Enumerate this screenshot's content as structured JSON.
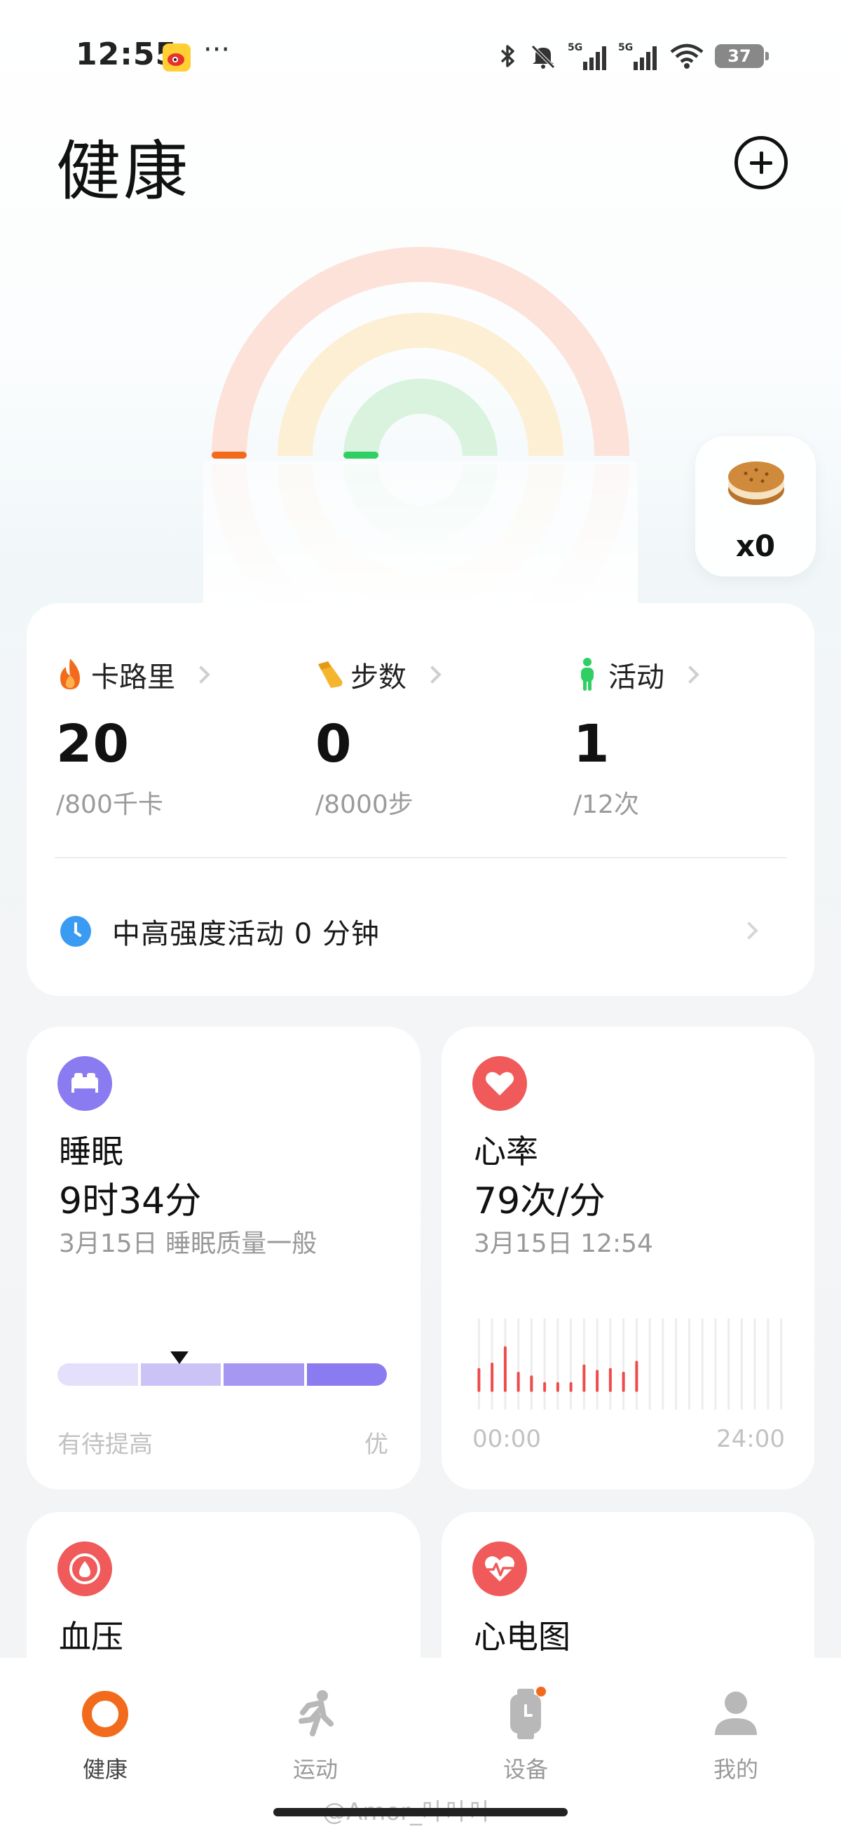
{
  "status_bar": {
    "time": "12:55",
    "dots": "···",
    "battery": "37",
    "network_label": "5G"
  },
  "header": {
    "title": "健康",
    "add_icon": "plus-circle-icon"
  },
  "rings": {
    "outer_color": "#f26b1d",
    "middle_color": "#f5b52f",
    "inner_color": "#2fcf63",
    "outer_progress": 0.025,
    "middle_progress": 0.0,
    "inner_progress": 0.083
  },
  "reward": {
    "icon": "cookie-icon",
    "count": "x0"
  },
  "summary": {
    "calories": {
      "label": "卡路里",
      "value": "20",
      "goal": "/800千卡",
      "icon": "flame-icon",
      "color": "#f26b1d"
    },
    "steps": {
      "label": "步数",
      "value": "0",
      "goal": "/8000步",
      "icon": "shoe-icon",
      "color": "#f5b52f"
    },
    "activity": {
      "label": "活动",
      "value": "1",
      "goal": "/12次",
      "icon": "person-standing-icon",
      "color": "#2fcf63"
    },
    "intensity": {
      "text": "中高强度活动  0  分钟",
      "icon": "clock-icon"
    }
  },
  "sleep": {
    "title": "睡眠",
    "value": "9时34分",
    "sub": "3月15日 睡眠质量一般",
    "scale_low": "有待提高",
    "scale_high": "优",
    "icon": "bed-icon",
    "icon_color": "#8b7bf0",
    "quality_level": 0.37
  },
  "heart_rate": {
    "title": "心率",
    "value": "79次/分",
    "sub": "3月15日 12:54",
    "x_start": "00:00",
    "x_end": "24:00",
    "icon": "heart-icon",
    "icon_color": "#f05a5a"
  },
  "chart_data": {
    "type": "bar",
    "title": "",
    "xlabel": "",
    "ylabel": "",
    "x": [
      0,
      1,
      2,
      3,
      4,
      5,
      6,
      7,
      8,
      9,
      10,
      11,
      12
    ],
    "values": [
      72,
      75,
      84,
      70,
      68,
      64,
      62,
      63,
      74,
      71,
      72,
      70,
      76
    ],
    "x_ticks": [
      "00:00",
      "24:00"
    ],
    "ylim": [
      50,
      100
    ],
    "grid": true
  },
  "blood_pressure": {
    "title": "血压",
    "icon": "blood-drop-icon",
    "icon_color": "#f05a5a"
  },
  "ecg": {
    "title": "心电图",
    "icon": "ecg-heart-icon",
    "icon_color": "#f05a5a"
  },
  "bottom_nav": {
    "items": [
      {
        "label": "健康",
        "icon": "health-ring-icon",
        "active": true
      },
      {
        "label": "运动",
        "icon": "running-icon",
        "active": false
      },
      {
        "label": "设备",
        "icon": "watch-icon",
        "active": false
      },
      {
        "label": "我的",
        "icon": "profile-icon",
        "active": false
      }
    ]
  },
  "watermark": "@Amor_叶叶叶"
}
